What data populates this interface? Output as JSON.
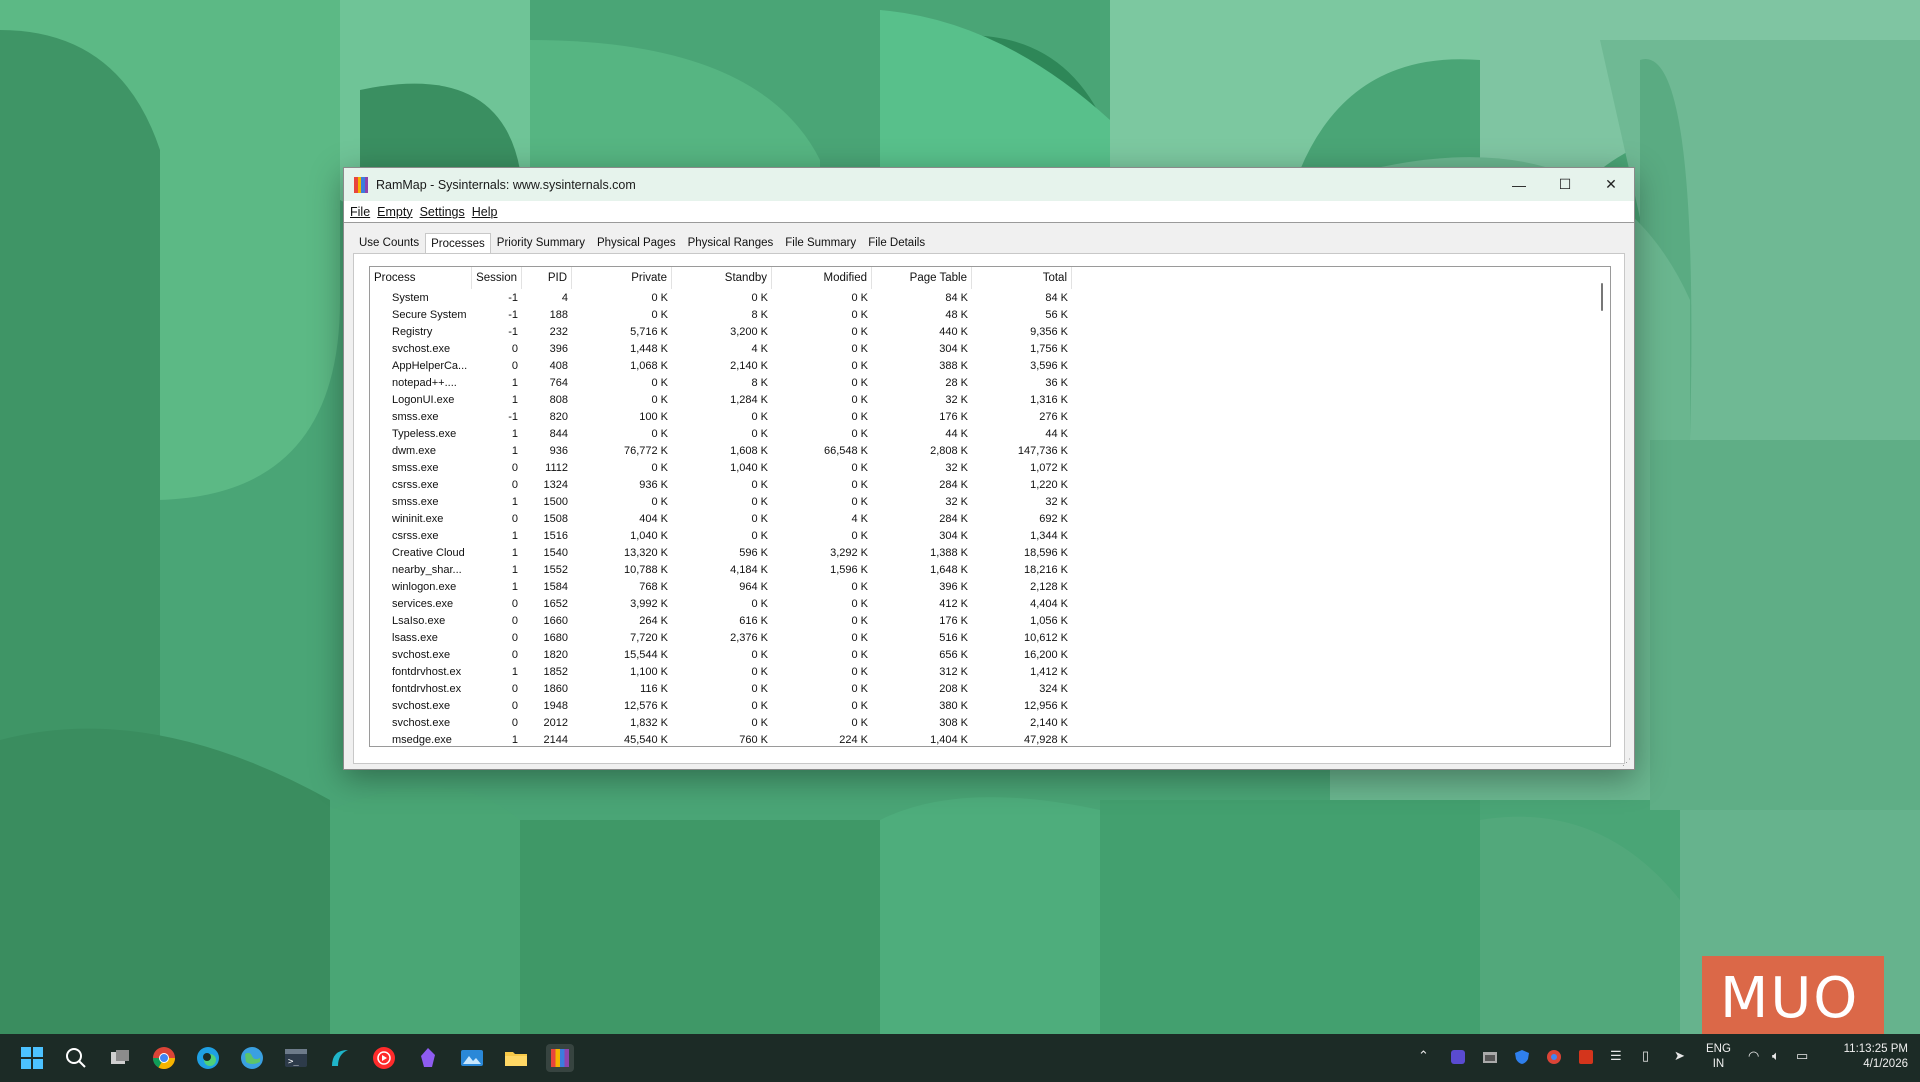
{
  "window": {
    "title": "RamMap - Sysinternals: www.sysinternals.com",
    "controls": {
      "minimize": "—",
      "maximize": "☐",
      "close": "✕"
    }
  },
  "menu": [
    "File",
    "Empty",
    "Settings",
    "Help"
  ],
  "tabs": [
    {
      "label": "Use Counts",
      "active": false
    },
    {
      "label": "Processes",
      "active": true
    },
    {
      "label": "Priority Summary",
      "active": false
    },
    {
      "label": "Physical Pages",
      "active": false
    },
    {
      "label": "Physical Ranges",
      "active": false
    },
    {
      "label": "File Summary",
      "active": false
    },
    {
      "label": "File Details",
      "active": false
    }
  ],
  "columns": [
    "Process",
    "Session",
    "PID",
    "Private",
    "Standby",
    "Modified",
    "Page Table",
    "Total"
  ],
  "rows": [
    [
      "System",
      "-1",
      "4",
      "0 K",
      "0 K",
      "0 K",
      "84 K",
      "84 K"
    ],
    [
      "Secure System",
      "-1",
      "188",
      "0 K",
      "8 K",
      "0 K",
      "48 K",
      "56 K"
    ],
    [
      "Registry",
      "-1",
      "232",
      "5,716 K",
      "3,200 K",
      "0 K",
      "440 K",
      "9,356 K"
    ],
    [
      "svchost.exe",
      "0",
      "396",
      "1,448 K",
      "4 K",
      "0 K",
      "304 K",
      "1,756 K"
    ],
    [
      "AppHelperCa...",
      "0",
      "408",
      "1,068 K",
      "2,140 K",
      "0 K",
      "388 K",
      "3,596 K"
    ],
    [
      "notepad++....",
      "1",
      "764",
      "0 K",
      "8 K",
      "0 K",
      "28 K",
      "36 K"
    ],
    [
      "LogonUI.exe",
      "1",
      "808",
      "0 K",
      "1,284 K",
      "0 K",
      "32 K",
      "1,316 K"
    ],
    [
      "smss.exe",
      "-1",
      "820",
      "100 K",
      "0 K",
      "0 K",
      "176 K",
      "276 K"
    ],
    [
      "Typeless.exe",
      "1",
      "844",
      "0 K",
      "0 K",
      "0 K",
      "44 K",
      "44 K"
    ],
    [
      "dwm.exe",
      "1",
      "936",
      "76,772 K",
      "1,608 K",
      "66,548 K",
      "2,808 K",
      "147,736 K"
    ],
    [
      "smss.exe",
      "0",
      "1112",
      "0 K",
      "1,040 K",
      "0 K",
      "32 K",
      "1,072 K"
    ],
    [
      "csrss.exe",
      "0",
      "1324",
      "936 K",
      "0 K",
      "0 K",
      "284 K",
      "1,220 K"
    ],
    [
      "smss.exe",
      "1",
      "1500",
      "0 K",
      "0 K",
      "0 K",
      "32 K",
      "32 K"
    ],
    [
      "wininit.exe",
      "0",
      "1508",
      "404 K",
      "0 K",
      "4 K",
      "284 K",
      "692 K"
    ],
    [
      "csrss.exe",
      "1",
      "1516",
      "1,040 K",
      "0 K",
      "0 K",
      "304 K",
      "1,344 K"
    ],
    [
      "Creative Cloud",
      "1",
      "1540",
      "13,320 K",
      "596 K",
      "3,292 K",
      "1,388 K",
      "18,596 K"
    ],
    [
      "nearby_shar...",
      "1",
      "1552",
      "10,788 K",
      "4,184 K",
      "1,596 K",
      "1,648 K",
      "18,216 K"
    ],
    [
      "winlogon.exe",
      "1",
      "1584",
      "768 K",
      "964 K",
      "0 K",
      "396 K",
      "2,128 K"
    ],
    [
      "services.exe",
      "0",
      "1652",
      "3,992 K",
      "0 K",
      "0 K",
      "412 K",
      "4,404 K"
    ],
    [
      "LsaIso.exe",
      "0",
      "1660",
      "264 K",
      "616 K",
      "0 K",
      "176 K",
      "1,056 K"
    ],
    [
      "lsass.exe",
      "0",
      "1680",
      "7,720 K",
      "2,376 K",
      "0 K",
      "516 K",
      "10,612 K"
    ],
    [
      "svchost.exe",
      "0",
      "1820",
      "15,544 K",
      "0 K",
      "0 K",
      "656 K",
      "16,200 K"
    ],
    [
      "fontdrvhost.ex",
      "1",
      "1852",
      "1,100 K",
      "0 K",
      "0 K",
      "312 K",
      "1,412 K"
    ],
    [
      "fontdrvhost.ex",
      "0",
      "1860",
      "116 K",
      "0 K",
      "0 K",
      "208 K",
      "324 K"
    ],
    [
      "svchost.exe",
      "0",
      "1948",
      "12,576 K",
      "0 K",
      "0 K",
      "380 K",
      "12,956 K"
    ],
    [
      "svchost.exe",
      "0",
      "2012",
      "1,832 K",
      "0 K",
      "0 K",
      "308 K",
      "2,140 K"
    ],
    [
      "msedge.exe",
      "1",
      "2144",
      "45,540 K",
      "760 K",
      "224 K",
      "1,404 K",
      "47,928 K"
    ]
  ],
  "taskbar": {
    "language": "ENG",
    "region": "IN",
    "time": "11:13:25 PM",
    "date": "4/1/2026"
  },
  "watermark": "MUO",
  "colors": {
    "accent": "#0078d4",
    "taskbar": "#1c2b26",
    "titlebar": "#e6f3ec"
  }
}
